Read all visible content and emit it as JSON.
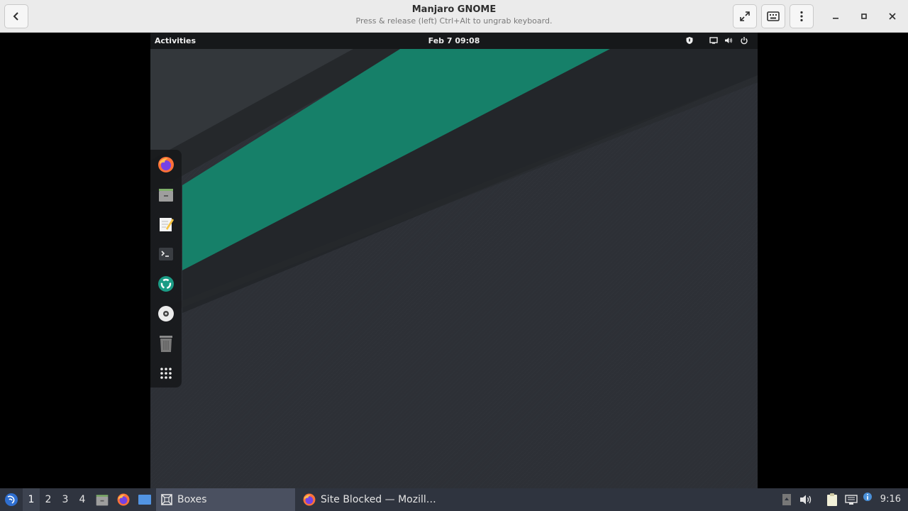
{
  "window": {
    "title": "Manjaro GNOME",
    "subtitle": "Press & release (left) Ctrl+Alt to ungrab keyboard.",
    "back_icon": "chevron-left-icon",
    "fullscreen_icon": "fullscreen-icon",
    "keyboard_icon": "keyboard-icon",
    "menu_icon": "kebab-menu-icon",
    "minimize_icon": "minimize-icon",
    "maximize_icon": "maximize-icon",
    "close_icon": "close-icon"
  },
  "guest": {
    "topbar": {
      "activities": "Activities",
      "clock": "Feb 7  09:08",
      "tray": [
        "shield-icon",
        "screen-icon",
        "volume-icon",
        "power-icon"
      ]
    },
    "dash": {
      "items": [
        {
          "name": "Firefox",
          "icon": "firefox-icon"
        },
        {
          "name": "Files",
          "icon": "file-cabinet-icon"
        },
        {
          "name": "Text Editor",
          "icon": "text-editor-icon"
        },
        {
          "name": "Terminal",
          "icon": "terminal-icon"
        },
        {
          "name": "Software",
          "icon": "software-icon"
        },
        {
          "name": "Disc",
          "icon": "disc-icon"
        },
        {
          "name": "Trash",
          "icon": "trash-icon"
        },
        {
          "name": "Show Applications",
          "icon": "app-grid-icon"
        }
      ]
    },
    "colors": {
      "accent": "#168069",
      "panel": "#16181a",
      "wallpaper": "#2c2f33"
    }
  },
  "taskbar": {
    "workspaces": [
      "1",
      "2",
      "3",
      "4"
    ],
    "active_workspace": "1",
    "tasks": [
      {
        "label": "Boxes",
        "icon": "boxes-icon",
        "active": true
      },
      {
        "label": "Site Blocked — Mozill…",
        "icon": "firefox-icon",
        "active": false
      }
    ],
    "clock": "9:16"
  }
}
